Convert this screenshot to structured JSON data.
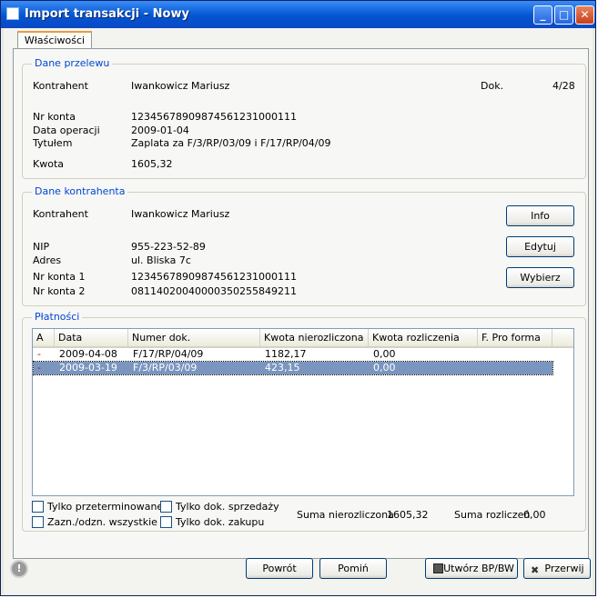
{
  "window": {
    "title": "Import transakcji - Nowy"
  },
  "tabs": [
    "Właściwości"
  ],
  "dane_przelewu": {
    "legend": "Dane przelewu",
    "kontrahent_label": "Kontrahent",
    "kontrahent": "Iwankowicz Mariusz",
    "dok_label": "Dok.",
    "dok": "4/28",
    "nr_konta_label": "Nr konta",
    "nr_konta": "12345678909874561231000111",
    "data_operacji_label": "Data operacji",
    "data_operacji": "2009-01-04",
    "tytulem_label": "Tytułem",
    "tytulem": "Zaplata za F/3/RP/03/09 i F/17/RP/04/09",
    "kwota_label": "Kwota",
    "kwota": "1605,32"
  },
  "dane_kontrahenta": {
    "legend": "Dane kontrahenta",
    "kontrahent_label": "Kontrahent",
    "kontrahent": "Iwankowicz Mariusz",
    "nip_label": "NIP",
    "nip": "955-223-52-89",
    "adres_label": "Adres",
    "adres": "ul. Bliska 7c",
    "nr_konta1_label": "Nr konta 1",
    "nr_konta1": "12345678909874561231000111",
    "nr_konta2_label": "Nr konta 2",
    "nr_konta2": "08114020040000350255849211",
    "info_button": "Info",
    "edytuj_button": "Edytuj",
    "wybierz_button": "Wybierz"
  },
  "platnosci": {
    "legend": "Płatności",
    "columns": [
      "A",
      "Data",
      "Numer dok.",
      "Kwota nierozliczona",
      "Kwota rozliczenia",
      "F. Pro forma"
    ],
    "rows": [
      {
        "a": "-",
        "data": "2009-04-08",
        "numer": "F/17/RP/04/09",
        "kwota_nierozl": "1182,17",
        "kwota_rozl": "0,00",
        "pro_forma": ""
      },
      {
        "a": "-",
        "data": "2009-03-19",
        "numer": "F/3/RP/03/09",
        "kwota_nierozl": "423,15",
        "kwota_rozl": "0,00",
        "pro_forma": ""
      }
    ],
    "filters": {
      "tylko_przeterminowane": "Tylko przeterminowane",
      "zazn_odzn": "Zazn./odzn. wszystkie",
      "tylko_sprzedazy": "Tylko dok. sprzedaży",
      "tylko_zakupu": "Tylko dok. zakupu"
    },
    "suma_nierozliczona_label": "Suma nierozliczona",
    "suma_nierozliczona": "1605,32",
    "suma_rozliczen_label": "Suma rozliczeń",
    "suma_rozliczen": "0,00"
  },
  "footer": {
    "powrot": "Powrót",
    "pomin": "Pomiń",
    "utworz": "Utwórz BP/BW",
    "przerwij": "Przerwij"
  }
}
